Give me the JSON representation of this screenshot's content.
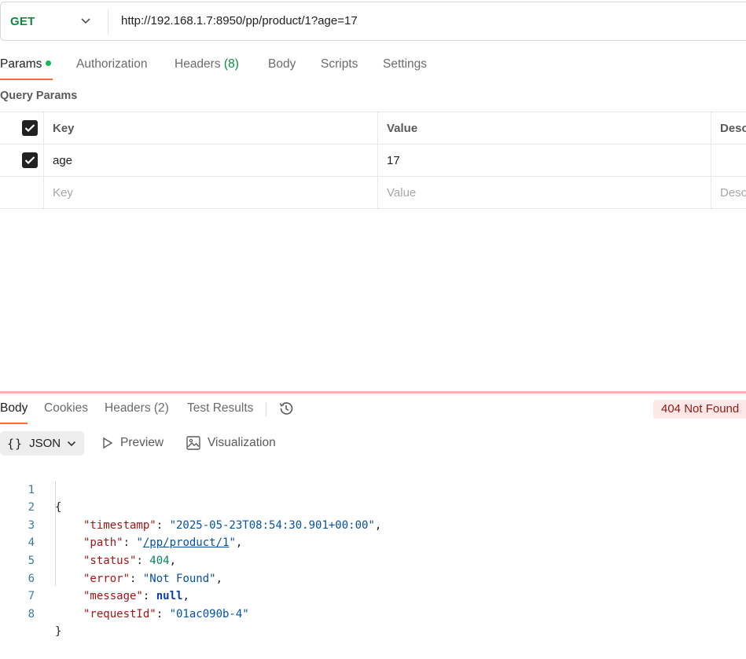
{
  "request": {
    "method": "GET",
    "url": "http://192.168.1.7:8950/pp/product/1?age=17"
  },
  "request_tabs": {
    "params": "Params",
    "authorization": "Authorization",
    "headers": "Headers",
    "headers_count": "(8)",
    "body": "Body",
    "scripts": "Scripts",
    "settings": "Settings"
  },
  "query_params": {
    "title": "Query Params",
    "columns": {
      "key": "Key",
      "value": "Value",
      "description": "Desc"
    },
    "rows": [
      {
        "key": "age",
        "value": "17",
        "checked": true
      }
    ],
    "placeholder": {
      "key": "Key",
      "value": "Value",
      "description": "Desc"
    }
  },
  "response_tabs": {
    "body": "Body",
    "cookies": "Cookies",
    "headers": "Headers (2)",
    "test_results": "Test Results"
  },
  "status": "404 Not Found",
  "format": {
    "braces": "{}",
    "selected": "JSON",
    "preview": "Preview",
    "visualization": "Visualization"
  },
  "response_body": {
    "line_numbers": [
      "1",
      "2",
      "3",
      "4",
      "5",
      "6",
      "7",
      "8"
    ],
    "open_brace": "{",
    "close_brace": "}",
    "fields": [
      {
        "key": "\"timestamp\"",
        "value": "\"2025-05-23T08:54:30.901+00:00\"",
        "comma": ","
      },
      {
        "key": "\"path\"",
        "value": "/pp/product/1",
        "comma": ","
      },
      {
        "key": "\"status\"",
        "value": "404",
        "comma": ","
      },
      {
        "key": "\"error\"",
        "value": "\"Not Found\"",
        "comma": ","
      },
      {
        "key": "\"message\"",
        "value": "null",
        "comma": ","
      },
      {
        "key": "\"requestId\"",
        "value": "\"01ac090b-4\"",
        "comma": ""
      }
    ]
  },
  "colors": {
    "method_green": "#0f8a3c",
    "accent_orange": "#ff6c37",
    "error_red": "#8e1a10",
    "error_bg": "#fde8e8"
  }
}
